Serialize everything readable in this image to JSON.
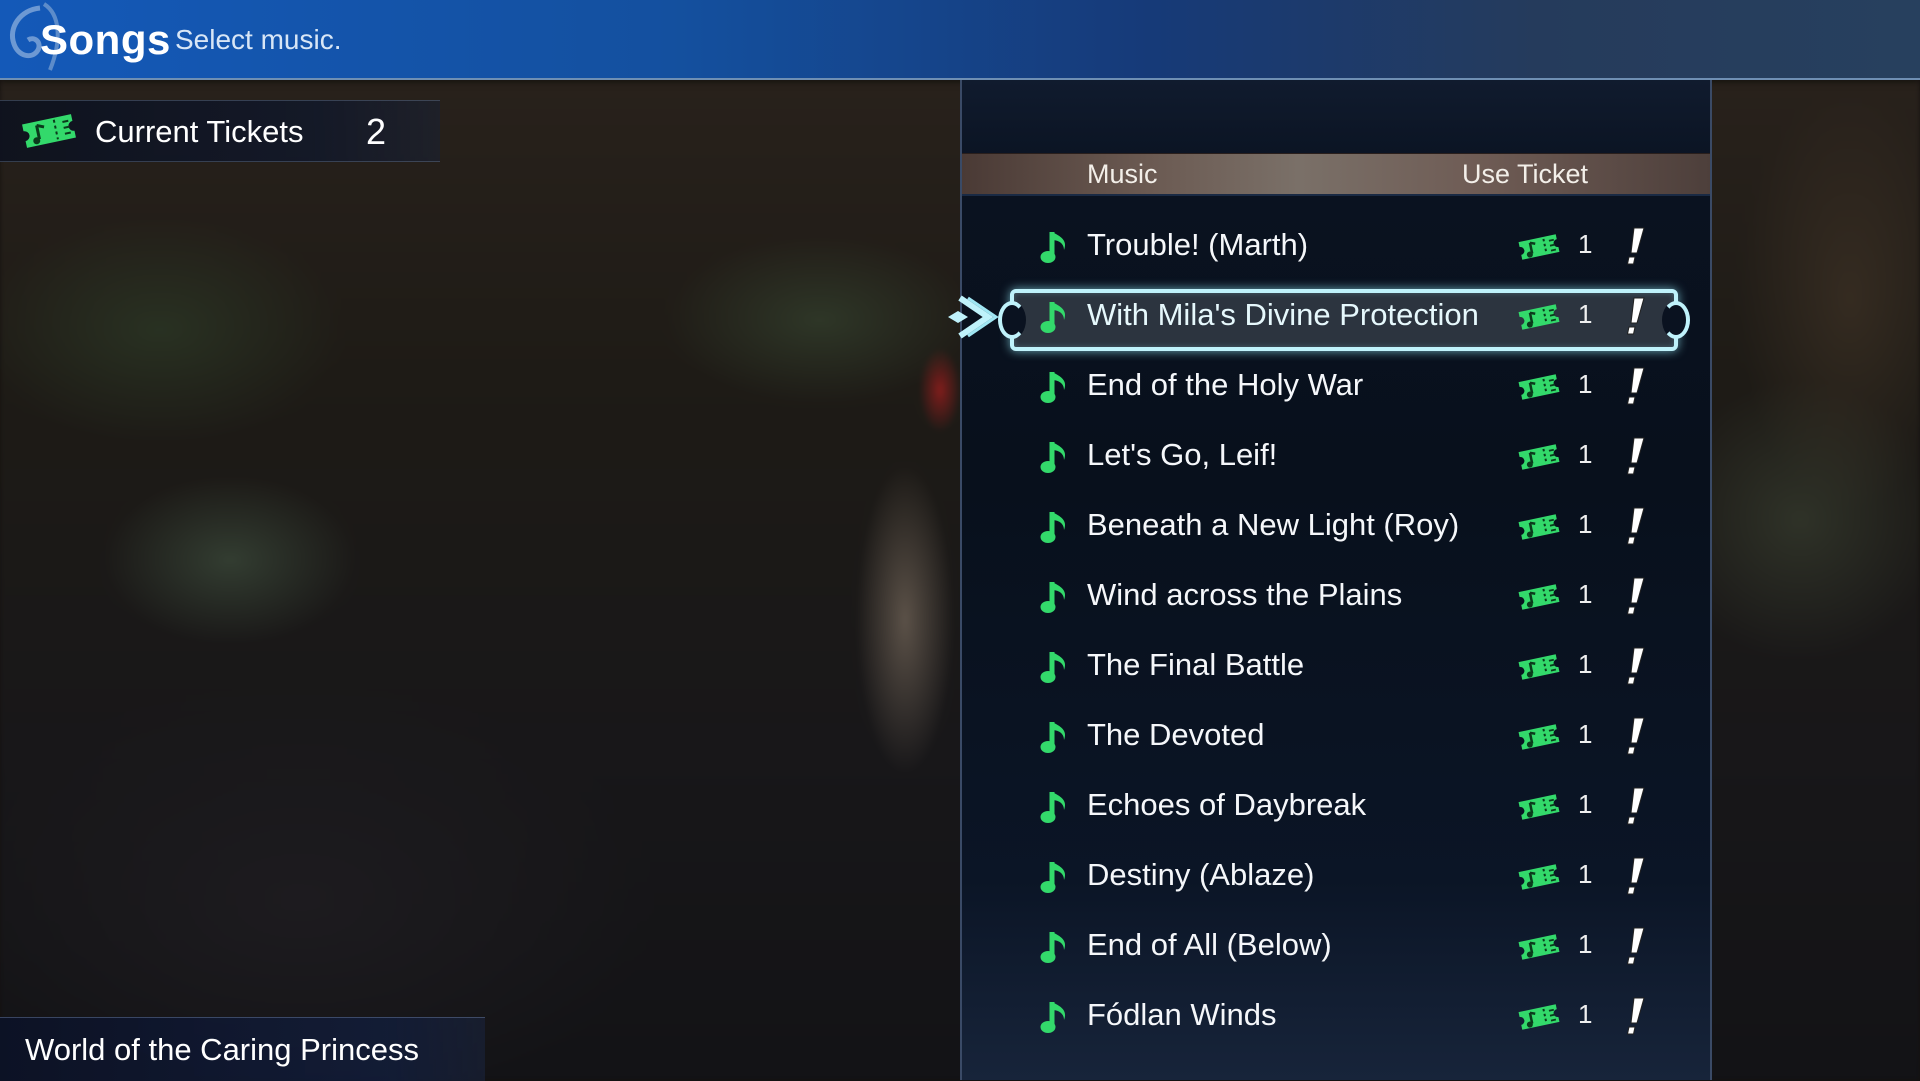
{
  "header": {
    "title": "Songs",
    "subtitle": "Select music."
  },
  "tickets": {
    "label": "Current Tickets",
    "count": "2",
    "icon": "ticket-icon"
  },
  "location": {
    "name": "World of the Caring Princess"
  },
  "panel": {
    "columns": {
      "music": "Music",
      "use_ticket": "Use Ticket"
    },
    "selected_index": 1,
    "songs": [
      {
        "title": "Trouble! (Marth)",
        "cost": "1",
        "new": true
      },
      {
        "title": "With Mila's Divine Protection",
        "cost": "1",
        "new": true
      },
      {
        "title": "End of the Holy War",
        "cost": "1",
        "new": true
      },
      {
        "title": "Let's Go, Leif!",
        "cost": "1",
        "new": true
      },
      {
        "title": "Beneath a New Light (Roy)",
        "cost": "1",
        "new": true
      },
      {
        "title": "Wind across the Plains",
        "cost": "1",
        "new": true
      },
      {
        "title": "The Final Battle",
        "cost": "1",
        "new": true
      },
      {
        "title": "The Devoted",
        "cost": "1",
        "new": true
      },
      {
        "title": "Echoes of Daybreak",
        "cost": "1",
        "new": true
      },
      {
        "title": "Destiny (Ablaze)",
        "cost": "1",
        "new": true
      },
      {
        "title": "End of All (Below)",
        "cost": "1",
        "new": true
      },
      {
        "title": "Fódlan Winds",
        "cost": "1",
        "new": true
      }
    ]
  },
  "colors": {
    "accent_green": "#33d96b",
    "selection_glow": "#bff2fb",
    "header_blue": "#1459b8"
  }
}
